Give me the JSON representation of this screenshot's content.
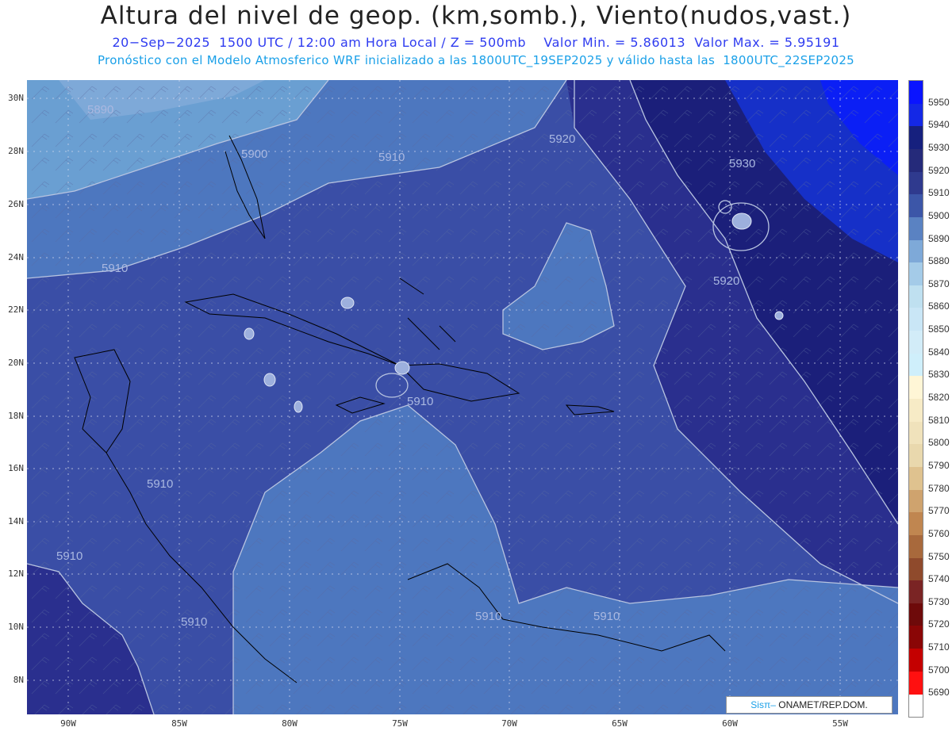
{
  "header": {
    "title": "Altura del nivel de geop. (km,somb.), Viento(nudos,vast.)",
    "subtitle1": "20−Sep−2025  1500 UTC / 12:00 am Hora Local / Z = 500mb    Valor Min. = 5.86013  Valor Max. = 5.95191",
    "subtitle2": "Pronóstico con el Modelo Atmosferico WRF inicializado a las 1800UTC_19SEP2025 y válido hasta las  1800UTC_22SEP2025"
  },
  "map": {
    "lat_labels": [
      "30N",
      "28N",
      "26N",
      "24N",
      "22N",
      "20N",
      "18N",
      "16N",
      "14N",
      "12N",
      "10N",
      "8N"
    ],
    "lon_labels": [
      "90W",
      "85W",
      "80W",
      "75W",
      "70W",
      "65W",
      "60W",
      "55W"
    ],
    "contour_labels": [
      "5890",
      "5900",
      "5910",
      "5920",
      "5930",
      "5910",
      "5920",
      "5910",
      "5910",
      "5910",
      "5910",
      "5910",
      "5910"
    ],
    "colors": {
      "c5890": "#6a9fd2",
      "c5900": "#4d77bf",
      "c5910": "#3a4ea6",
      "c5920": "#2a2f8e",
      "c5930": "#1b1f7a",
      "c5940": "#1630c8",
      "c5950": "#0b1ff5",
      "contour": "#b8c4e0",
      "grid": "#d8dcf0"
    }
  },
  "colorbar": {
    "labels": [
      "5950",
      "5940",
      "5930",
      "5920",
      "5910",
      "5900",
      "5890",
      "5880",
      "5870",
      "5860",
      "5850",
      "5840",
      "5830",
      "5820",
      "5810",
      "5800",
      "5790",
      "5780",
      "5770",
      "5760",
      "5750",
      "5740",
      "5730",
      "5720",
      "5710",
      "5700",
      "5690"
    ],
    "colors": [
      "#0a14ff",
      "#1428e6",
      "#16207e",
      "#252a7a",
      "#2f3a8e",
      "#3c56a8",
      "#5a82c2",
      "#7ea9d8",
      "#a4cbe8",
      "#bfe0f0",
      "#c9e6f6",
      "#d2ecf8",
      "#cfeffb",
      "#fff6d6",
      "#f7ebc6",
      "#f0e2bb",
      "#e9d8ad",
      "#dfc28f",
      "#cfa36e",
      "#c08650",
      "#a8693c",
      "#8f4a2c",
      "#7a2424",
      "#6e0a0a",
      "#8a0606",
      "#c40000",
      "#ff1010"
    ]
  },
  "credit": {
    "brand": "Sisπ‒",
    "org": " ONAMET/REP.DOM."
  }
}
